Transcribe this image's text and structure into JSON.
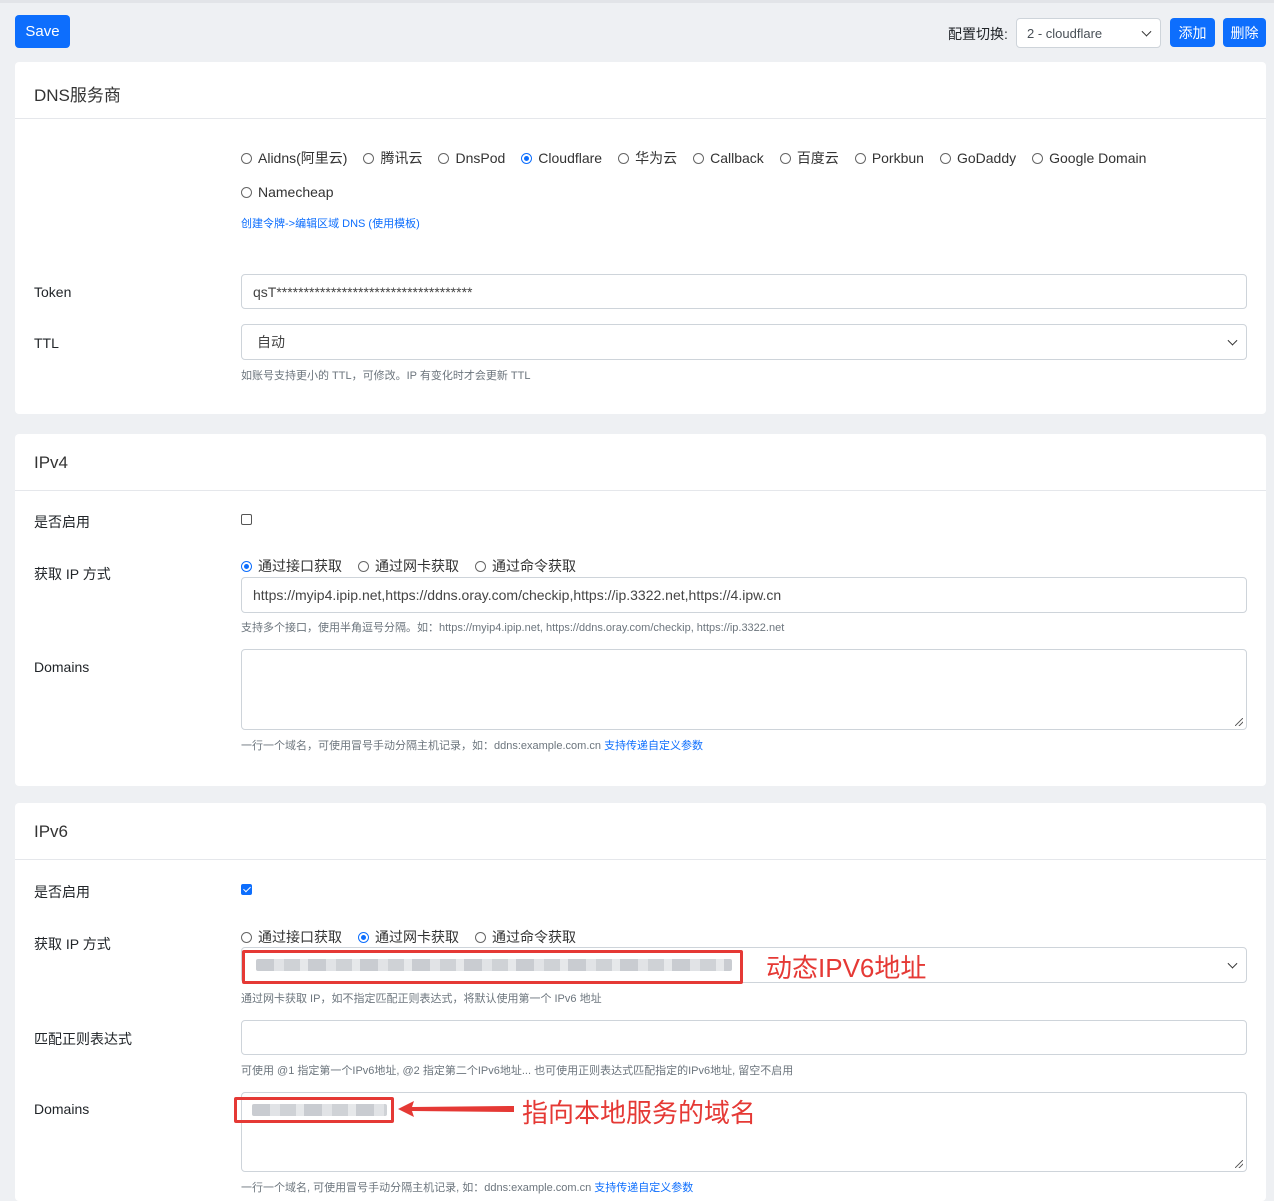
{
  "toolbar": {
    "save_label": "Save",
    "config_label": "配置切换:",
    "config_selected": "2 - cloudflare",
    "add_label": "添加",
    "delete_label": "删除"
  },
  "dns": {
    "title": "DNS服务商",
    "providers": [
      "Alidns(阿里云)",
      "腾讯云",
      "DnsPod",
      "Cloudflare",
      "华为云",
      "Callback",
      "百度云",
      "Porkbun",
      "GoDaddy",
      "Google Domain",
      "Namecheap"
    ],
    "selected_provider": "Cloudflare",
    "provider_link": "创建令牌->编辑区域 DNS (使用模板)",
    "token_label": "Token",
    "token_value": "qsT************************************",
    "ttl_label": "TTL",
    "ttl_value": "自动",
    "ttl_help": "如账号支持更小的 TTL，可修改。IP 有变化时才会更新 TTL"
  },
  "ipv4": {
    "title": "IPv4",
    "enable_label": "是否启用",
    "enabled": false,
    "method_label": "获取 IP 方式",
    "methods": [
      "通过接口获取",
      "通过网卡获取",
      "通过命令获取"
    ],
    "selected_method": "通过接口获取",
    "url_value": "https://myip4.ipip.net,https://ddns.oray.com/checkip,https://ip.3322.net,https://4.ipw.cn",
    "url_help": "支持多个接口，使用半角逗号分隔。如：https://myip4.ipip.net, https://ddns.oray.com/checkip, https://ip.3322.net",
    "domains_label": "Domains",
    "domains_help": "一行一个域名，可使用冒号手动分隔主机记录，如：ddns:example.com.cn",
    "domains_help_link": "支持传递自定义参数"
  },
  "ipv6": {
    "title": "IPv6",
    "enable_label": "是否启用",
    "enabled": true,
    "method_label": "获取 IP 方式",
    "methods": [
      "通过接口获取",
      "通过网卡获取",
      "通过命令获取"
    ],
    "selected_method": "通过网卡获取",
    "nic_help": "通过网卡获取 IP，如不指定匹配正则表达式，将默认使用第一个 IPv6 地址",
    "regex_label": "匹配正则表达式",
    "regex_help": "可使用 @1 指定第一个IPv6地址, @2 指定第二个IPv6地址... 也可使用正则表达式匹配指定的IPv6地址, 留空不启用",
    "domains_label": "Domains",
    "domains_help": "一行一个域名, 可使用冒号手动分隔主机记录, 如：ddns:example.com.cn",
    "domains_help_link": "支持传递自定义参数"
  },
  "annotations": {
    "ipv6_addr": "动态IPV6地址",
    "local_domain": "指向本地服务的域名"
  },
  "colors": {
    "primary": "#0d6efd",
    "annotation": "#e53935"
  }
}
